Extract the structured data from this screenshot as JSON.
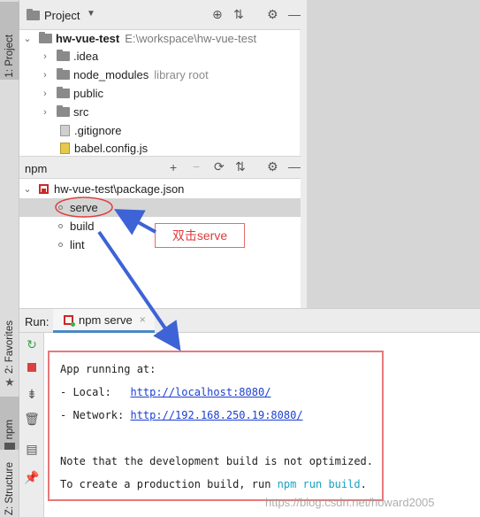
{
  "stripe": {
    "project_tab": "1: Project",
    "favorites_tab": "2: Favorites",
    "npm_tab": "npm",
    "structure_tab": "Z: Structure"
  },
  "project": {
    "title": "Project",
    "root": {
      "name": "hw-vue-test",
      "path": "E:\\workspace\\hw-vue-test"
    },
    "items": [
      {
        "name": ".idea",
        "note": ""
      },
      {
        "name": "node_modules",
        "note": "library root"
      },
      {
        "name": "public",
        "note": ""
      },
      {
        "name": "src",
        "note": ""
      },
      {
        "name": ".gitignore",
        "note": ""
      },
      {
        "name": "babel.config.js",
        "note": ""
      }
    ]
  },
  "npm": {
    "title": "npm",
    "package": "hw-vue-test\\package.json",
    "scripts": [
      "serve",
      "build",
      "lint"
    ]
  },
  "annotation": {
    "label": "双击serve"
  },
  "run": {
    "label": "Run:",
    "tab": "npm serve",
    "console": {
      "line1": "App running at:",
      "local_prefix": "- Local:   ",
      "local_url": "http://localhost:8080/",
      "network_prefix": "- Network: ",
      "network_url": "http://192.168.250.19:8080/",
      "note1": "Note that the development build is not optimized.",
      "note2_prefix": "To create a production build, run ",
      "note2_cmd": "npm run build",
      "note2_suffix": "."
    }
  },
  "watermark": "https://blog.csdn.net/howard2005",
  "colors": {
    "annotation_red": "#e03a3a",
    "arrow_blue": "#3d63d6",
    "link_blue": "#1a3fd1",
    "cmd_cyan": "#16a3c4"
  }
}
